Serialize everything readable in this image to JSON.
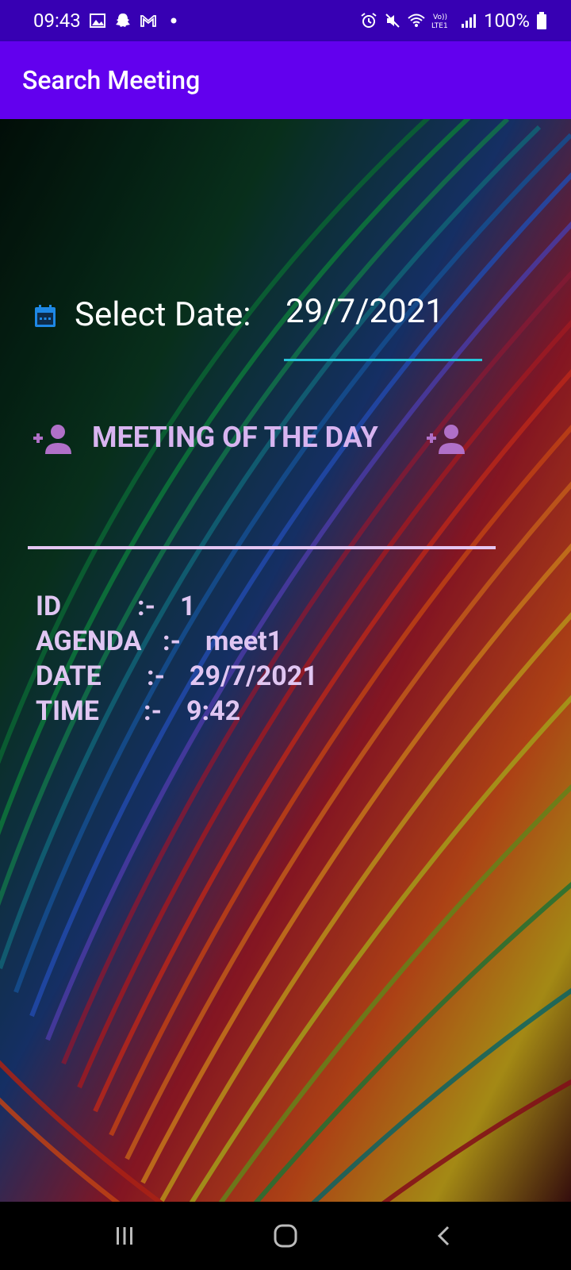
{
  "status_bar": {
    "time": "09:43",
    "battery": "100%",
    "icons": [
      "image-icon",
      "snapchat-icon",
      "gmail-icon",
      "dot-icon",
      "alarm-icon",
      "mute-icon",
      "wifi-icon",
      "volte-icon",
      "signal-icon",
      "battery-icon"
    ]
  },
  "app_bar": {
    "title": "Search Meeting"
  },
  "date_picker": {
    "label": "Select Date:",
    "value": "29/7/2021",
    "icon": "calendar-icon"
  },
  "section": {
    "title": "MEETING OF THE DAY",
    "icon": "add-person-icon"
  },
  "meeting": {
    "id_label": "ID",
    "id_sep": ":-",
    "id_value": "1",
    "agenda_label": "AGENDA",
    "agenda_sep": ":-",
    "agenda_value": "meet1",
    "date_label": "DATE",
    "date_sep": ":-",
    "date_value": "29/7/2021",
    "time_label": "TIME",
    "time_sep": ":-",
    "time_value": "9:42"
  },
  "colors": {
    "status_bar": "#3700b3",
    "app_bar": "#6200ee",
    "accent": "#26c6da",
    "text_lilac": "#d8b4f0"
  }
}
